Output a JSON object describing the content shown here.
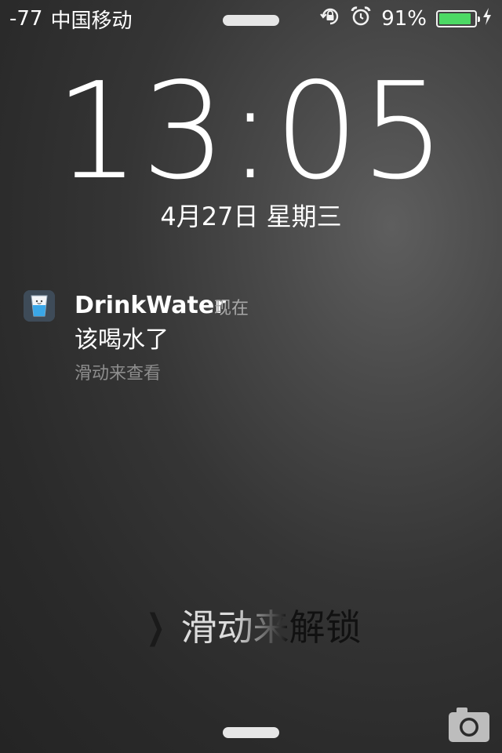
{
  "status_bar": {
    "signal": "-77",
    "carrier": "中国移动",
    "battery_percent": "91%",
    "battery_level": 0.91,
    "icons": [
      "orientation-lock-icon",
      "alarm-icon",
      "battery-icon",
      "charging-bolt-icon"
    ],
    "battery_color": "#4cd964"
  },
  "lock_screen": {
    "time": "13:05",
    "date": "4月27日 星期三"
  },
  "notification": {
    "app_name": "DrinkWater",
    "time": "现在",
    "message": "该喝水了",
    "hint": "滑动来查看",
    "icon": "drink-water-app-icon"
  },
  "unlock": {
    "label": "滑动来解锁",
    "chevron": "❯"
  },
  "camera": {
    "icon": "camera-icon"
  }
}
